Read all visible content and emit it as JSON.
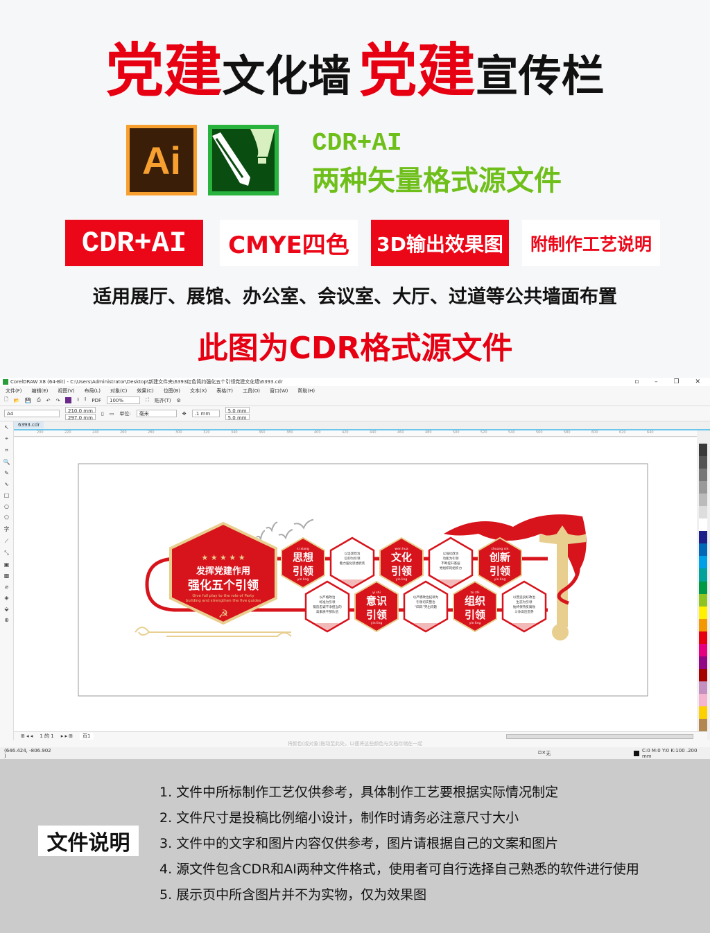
{
  "header": {
    "title_parts": [
      "党建",
      "文化墙",
      "党建",
      "宣传栏"
    ],
    "logos": {
      "ai_text": "Ai"
    },
    "format_line1": "CDR+AI",
    "format_line2": "两种矢量格式源文件",
    "badges": [
      "CDR+AI",
      "CMYE四色",
      "3D输出效果图",
      "附制作工艺说明"
    ],
    "subtitle": "适用展厅、展馆、办公室、会议室、大厅、过道等公共墙面布置",
    "source_notice": "此图为CDR格式源文件",
    "colors": {
      "red": "#e60012",
      "green": "#6fbf1a"
    }
  },
  "coreldraw": {
    "title_bar": "CorelDRAW X8 (64-Bit) - C:\\Users\\Administrator\\Desktop\\新建文件夹\\6393红色简约强化五个引领党建文化墙\\6393.cdr",
    "menu": [
      "文件(F)",
      "编辑(E)",
      "视图(V)",
      "布局(L)",
      "对象(C)",
      "效果(C)",
      "位图(B)",
      "文本(X)",
      "表格(T)",
      "工具(O)",
      "窗口(W)",
      "帮助(H)"
    ],
    "toolbar": {
      "zoom": "100%",
      "snap": "贴齐(T)"
    },
    "property_bar": {
      "page_size": "A4",
      "width": "210.0 mm",
      "height": "297.0 mm",
      "units_label": "单位:",
      "units": "毫米",
      "nudge": ".1 mm",
      "dup_x": "5.0 mm",
      "dup_y": "5.0 mm"
    },
    "doc_tab": "6393.cdr",
    "ruler_ticks": [
      "200",
      "220",
      "240",
      "260",
      "280",
      "300",
      "320",
      "340",
      "360",
      "380",
      "400",
      "420",
      "440",
      "460",
      "480",
      "500",
      "520",
      "540",
      "560",
      "580",
      "600",
      "620",
      "640"
    ],
    "page_nav": {
      "page_of": "1 的 1",
      "page_tab": "页1"
    },
    "color_hint": "将颜色(或对象)拖动至此处，以便将这些颜色与文档存储在一起",
    "status": {
      "coords": "(646.424, -806.902 )",
      "fill": "无",
      "outline": "C:0 M:0 Y:0 K:100  .200 mm"
    },
    "palette_colors": [
      "#3a3a3a",
      "#555",
      "#777",
      "#999",
      "#bbb",
      "#ddd",
      "#fff",
      "#1d2088",
      "#0068b7",
      "#00a0e9",
      "#00a29a",
      "#009944",
      "#8fc31f",
      "#fff100",
      "#f39800",
      "#e60012",
      "#e4007f",
      "#920783",
      "#a40000",
      "#c490bf",
      "#f4b4d0",
      "#fdd000",
      "#b28850"
    ]
  },
  "design": {
    "main_title_1": "发挥党建作用",
    "main_title_2": "强化五个引领",
    "main_english_1": "Give full play to the role of Party",
    "main_english_2": "building and strengthen the five guides",
    "row1": [
      {
        "kind": "red",
        "pinyin": "si      xiang",
        "title1": "思想",
        "title2": "引领",
        "pinyin2": "yin      ling"
      },
      {
        "kind": "white",
        "lines": [
          "以坚定政治",
          "信仰为引领",
          "着力强化思想武装"
        ]
      },
      {
        "kind": "red",
        "pinyin": "wen      hua",
        "title1": "文化",
        "title2": "引领",
        "pinyin2": "yin      ling"
      },
      {
        "kind": "white",
        "lines": [
          "以强化政治",
          "功能为引领",
          "不断提升基层",
          "党组织的组织力"
        ]
      },
      {
        "kind": "red",
        "pinyin": "chuang   xin",
        "title1": "创新",
        "title2": "引领",
        "pinyin2": "yin      ling"
      }
    ],
    "row2": [
      {
        "kind": "white",
        "lines": [
          "以严格政治",
          "标准为引领",
          "锻造忠诚干净担当的",
          "高素质干部队伍"
        ]
      },
      {
        "kind": "red",
        "pinyin": "yi      shi",
        "title1": "意识",
        "title2": "引领",
        "pinyin2": "yin      ling"
      },
      {
        "kind": "white",
        "lines": [
          "以严明政治纪律为",
          "引领切实整治",
          "“四风”突出问题"
        ]
      },
      {
        "kind": "red",
        "pinyin": "zu      zhi",
        "title1": "组织",
        "title2": "引领",
        "pinyin2": "yin      ling"
      },
      {
        "kind": "white",
        "lines": [
          "以营造良好政治",
          "生态为引领",
          "始终保持反腐败",
          "斗争高压态势"
        ]
      }
    ],
    "colors": {
      "red": "#d7141c",
      "gold": "#e8cf8f"
    }
  },
  "notes": {
    "label": "文件说明",
    "items": [
      "1. 文件中所标制作工艺仅供参考，具体制作工艺要根据实际情况制定",
      "2. 文件尺寸是投稿比例缩小设计，制作时请务必注意尺寸大小",
      "3. 文件中的文字和图片内容仅供参考，图片请根据自己的文案和图片",
      "4. 源文件包含CDR和AI两种文件格式，使用者可自行选择自己熟悉的软件进行使用",
      "5. 展示页中所含图片并不为实物，仅为效果图"
    ]
  }
}
